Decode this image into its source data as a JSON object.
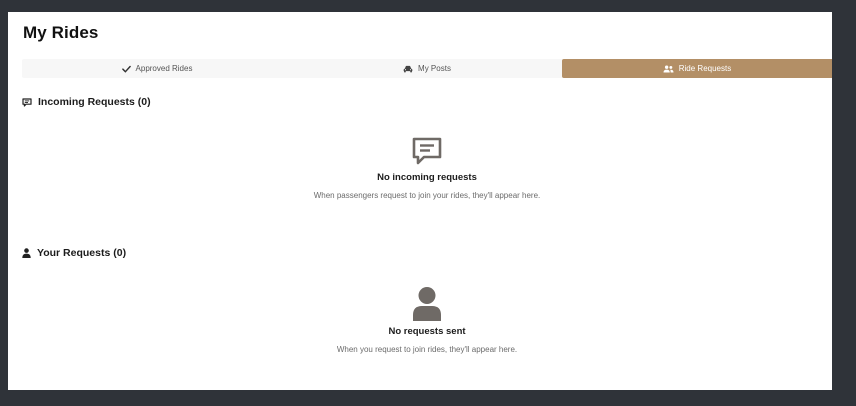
{
  "page": {
    "title": "My Rides"
  },
  "tabs": [
    {
      "label": "Approved Rides",
      "icon": "check-icon",
      "active": false
    },
    {
      "label": "My Posts",
      "icon": "car-icon",
      "active": false
    },
    {
      "label": "Ride Requests",
      "icon": "users-icon",
      "active": true
    }
  ],
  "incoming": {
    "heading": "Incoming Requests (0)",
    "icon": "message-icon",
    "empty_title": "No incoming requests",
    "empty_text": "When passengers request to join your rides, they'll appear here."
  },
  "yours": {
    "heading": "Your Requests (0)",
    "icon": "user-icon",
    "empty_title": "No requests sent",
    "empty_text": "When you request to join rides, they'll appear here."
  },
  "colors": {
    "accent": "#b38f66",
    "background": "#2f3339",
    "panel": "#ffffff",
    "icon_gray": "#6f6a66"
  }
}
